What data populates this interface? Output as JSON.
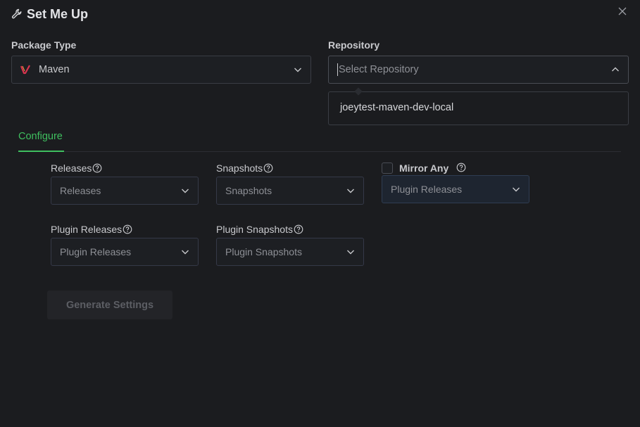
{
  "header": {
    "title": "Set Me Up",
    "icon": "wrench-icon"
  },
  "package_type": {
    "label": "Package Type",
    "value": "Maven",
    "icon": "maven-logo-icon"
  },
  "repository": {
    "label": "Repository",
    "placeholder": "Select Repository",
    "options": [
      "joeytest-maven-dev-local"
    ]
  },
  "tabs": [
    {
      "label": "Configure",
      "active": true
    }
  ],
  "fields": {
    "releases": {
      "label": "Releases",
      "placeholder": "Releases"
    },
    "snapshots": {
      "label": "Snapshots",
      "placeholder": "Snapshots"
    },
    "plugin_releases": {
      "label": "Plugin Releases",
      "placeholder": "Plugin Releases"
    },
    "plugin_snapshots": {
      "label": "Plugin Snapshots",
      "placeholder": "Plugin Snapshots"
    },
    "mirror_any": {
      "label": "Mirror Any",
      "checked": false,
      "placeholder": "Plugin Releases"
    }
  },
  "actions": {
    "generate_label": "Generate Settings"
  },
  "colors": {
    "background": "#1b1c1f",
    "accent": "#3fbf5f",
    "maven_red": "#d8344f"
  }
}
